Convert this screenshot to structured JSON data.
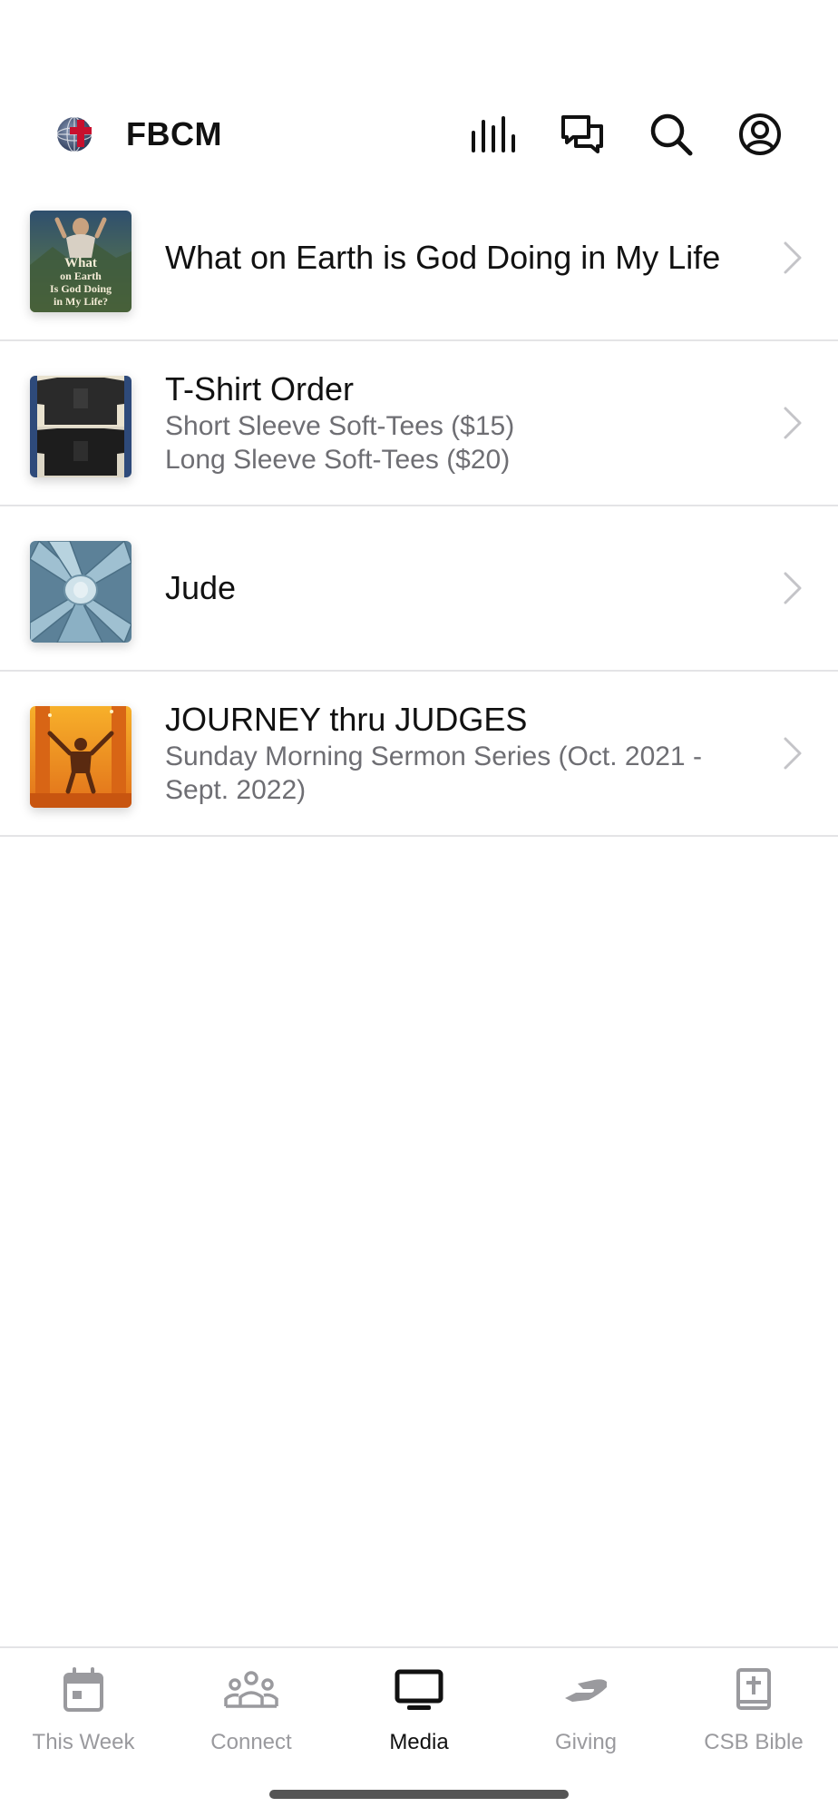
{
  "app": {
    "title": "FBCM",
    "logo": "church-globe-cross-logo"
  },
  "header_icons": [
    {
      "name": "audio-bars-icon"
    },
    {
      "name": "chat-icon"
    },
    {
      "name": "search-icon"
    },
    {
      "name": "profile-icon"
    }
  ],
  "media_items": [
    {
      "title": "What on Earth is God Doing in My Life",
      "subtitle_1": "",
      "subtitle_2": "",
      "thumb_text": [
        "What",
        "on Earth",
        "Is God Doing",
        "in My Life?"
      ]
    },
    {
      "title": "T-Shirt Order",
      "subtitle_1": "Short Sleeve Soft-Tees ($15)",
      "subtitle_2": "Long Sleeve Soft-Tees ($20)"
    },
    {
      "title": "Jude",
      "subtitle_1": "",
      "subtitle_2": ""
    },
    {
      "title": "JOURNEY thru JUDGES",
      "subtitle_1": "Sunday Morning Sermon Series (Oct. 2021 -",
      "subtitle_2": "Sept. 2022)"
    }
  ],
  "tabs": [
    {
      "label": "This Week",
      "icon": "calendar-icon",
      "active": false
    },
    {
      "label": "Connect",
      "icon": "group-icon",
      "active": false
    },
    {
      "label": "Media",
      "icon": "tv-icon",
      "active": true
    },
    {
      "label": "Giving",
      "icon": "giving-hand-icon",
      "active": false
    },
    {
      "label": "CSB Bible",
      "icon": "bible-icon",
      "active": false
    }
  ],
  "colors": {
    "active_tab": "#111111",
    "inactive_tab": "#9a9a9e",
    "subtitle": "#6e6e73",
    "divider": "#e4e4e6",
    "logo_cross": "#c8102e"
  }
}
